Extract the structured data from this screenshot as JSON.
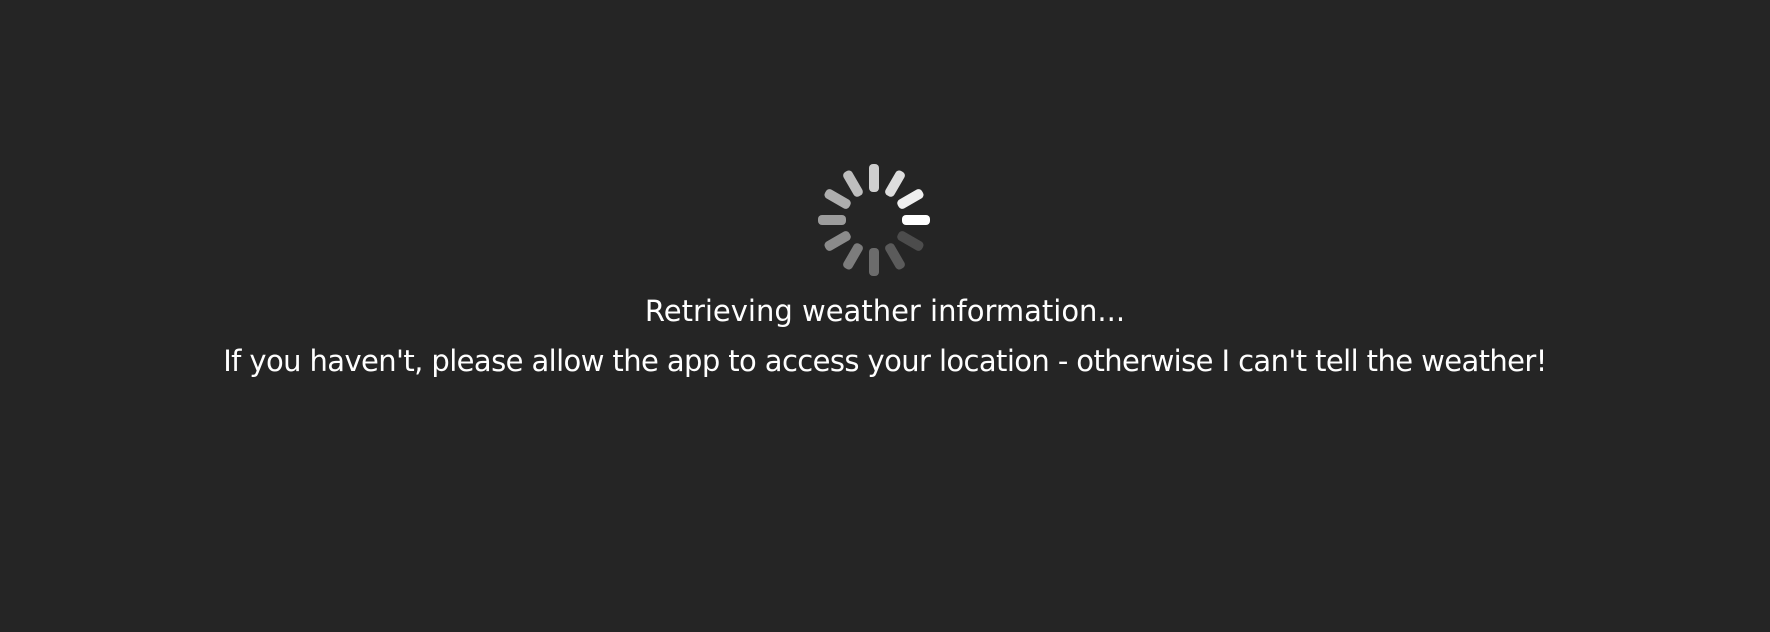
{
  "loading": {
    "spinner_icon": "loading-spinner-icon",
    "spinner_color": "#ffffff",
    "title": "Retrieving weather information...",
    "message": "If you haven't, please allow the app to access your location - otherwise I can't tell the weather!"
  },
  "colors": {
    "background": "#252525",
    "text": "#ffffff"
  }
}
